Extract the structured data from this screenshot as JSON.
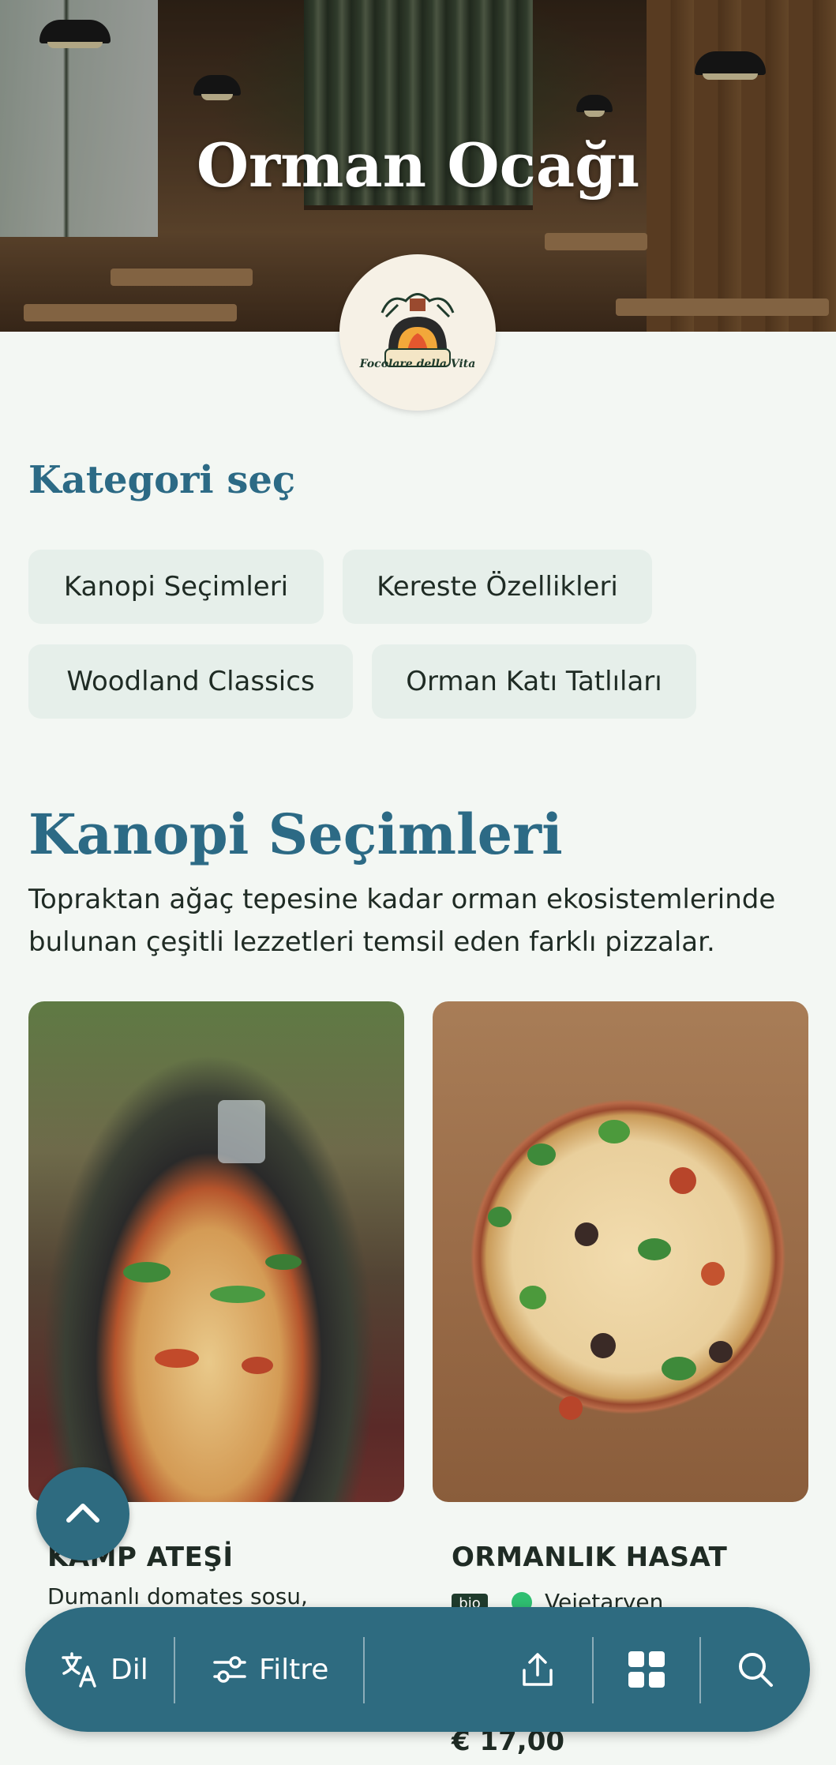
{
  "restaurant": {
    "name": "Orman Ocağı",
    "logo_text": "Focolare della Vita"
  },
  "categories": {
    "title": "Kategori seç",
    "items": [
      {
        "label": "Kanopi Seçimleri"
      },
      {
        "label": "Kereste Özellikleri"
      },
      {
        "label": "Woodland Classics"
      },
      {
        "label": "Orman Katı Tatlıları"
      }
    ]
  },
  "section": {
    "title": "Kanopi Seçimleri",
    "description": "Topraktan ağaç tepesine kadar orman ekosistemlerinde bulunan çeşitli lezzetleri temsil eden farklı pizzalar."
  },
  "products": [
    {
      "name": "KAMP ATEŞİ",
      "description": "Dumanlı domates sosu,"
    },
    {
      "name": "ORMANLIK HASAT",
      "badge": "bio",
      "tag": "Vejetaryen",
      "price": "€ 17,00"
    }
  ],
  "bottom_bar": {
    "language_label": "Dil",
    "filter_label": "Filtre"
  },
  "icons": {
    "scroll_top": "chevron-up-icon",
    "language": "translate-icon",
    "filter": "sliders-icon",
    "share": "share-icon",
    "grid": "grid-icon",
    "search": "search-icon"
  },
  "colors": {
    "accent": "#2c6a85",
    "bar": "#2e6b80",
    "background": "#f3f7f3",
    "chip": "#e6efea"
  }
}
